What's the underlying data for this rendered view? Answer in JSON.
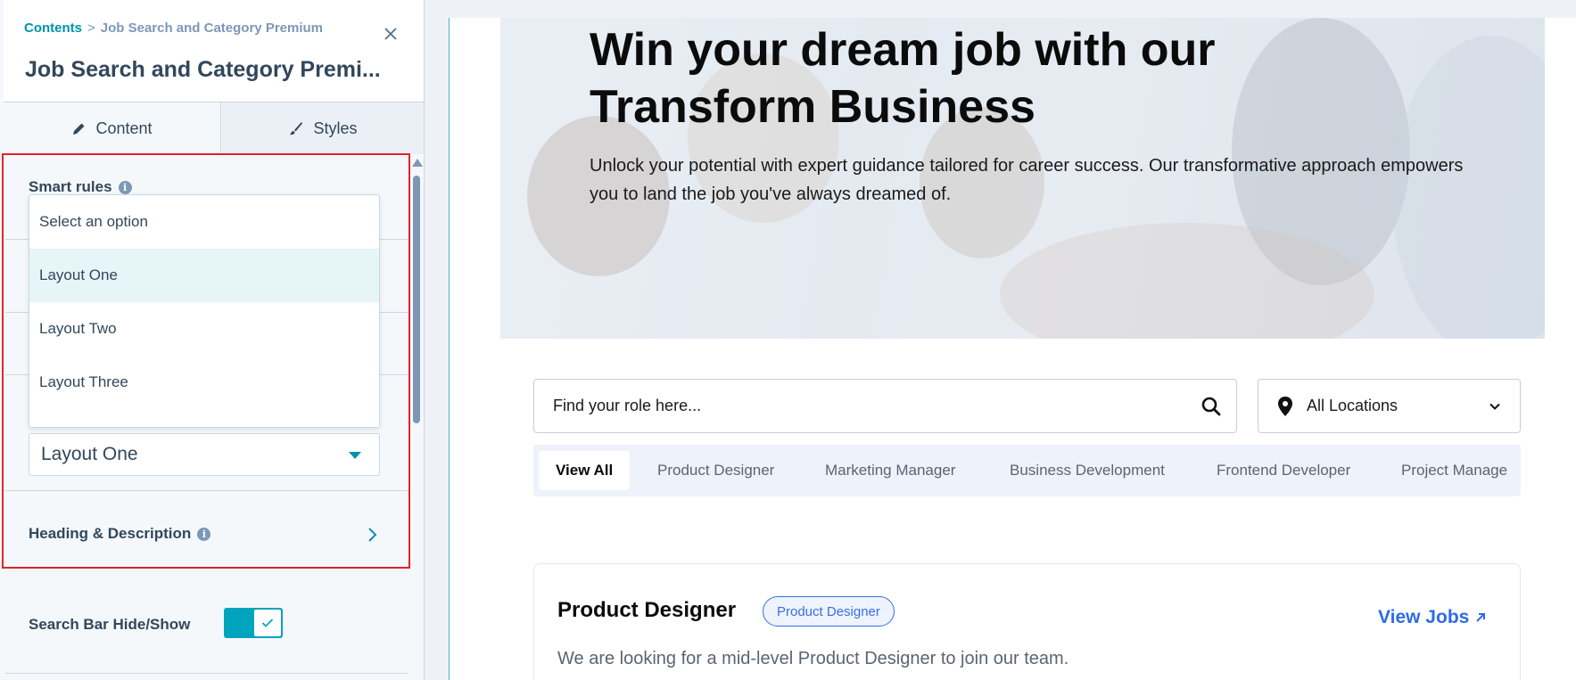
{
  "panel": {
    "breadcrumb": {
      "parent": "Contents",
      "separator": ">",
      "current": "Job Search and Category Premium"
    },
    "title": "Job Search and Category Premi...",
    "tabs": [
      {
        "label": "Content",
        "icon": "pencil-icon",
        "active": true
      },
      {
        "label": "Styles",
        "icon": "brush-icon",
        "active": false
      }
    ],
    "smart_rules_label": "Smart rules",
    "layout_dropdown": {
      "options": [
        "Select an option",
        "Layout One",
        "Layout Two",
        "Layout Three"
      ],
      "highlighted": "Layout One",
      "selected_value": "Layout One"
    },
    "heading_description_label": "Heading & Description",
    "search_bar_toggle": {
      "label": "Search Bar Hide/Show",
      "on": true
    }
  },
  "preview": {
    "hero": {
      "title": "Win your dream job with our Transform Business",
      "description": "Unlock your potential with expert guidance tailored for career success. Our transformative approach empowers you to land the job you've always dreamed of."
    },
    "search": {
      "placeholder": "Find your role here...",
      "icon": "search-icon"
    },
    "location": {
      "value": "All Locations",
      "icon": "map-pin-icon"
    },
    "categories": [
      "View All",
      "Product Designer",
      "Marketing Manager",
      "Business Development",
      "Frontend Developer",
      "Project Manage"
    ],
    "active_category": "View All",
    "job_card": {
      "title": "Product Designer",
      "badge": "Product Designer",
      "link": "View Jobs",
      "description": "We are looking for a mid-level Product Designer to join our team."
    }
  },
  "colors": {
    "accent_teal": "#00a4bd",
    "link_teal": "#0091ae",
    "highlight_border": "#e0232d",
    "view_jobs_blue": "#2e6be6",
    "panel_text": "#33475b"
  }
}
